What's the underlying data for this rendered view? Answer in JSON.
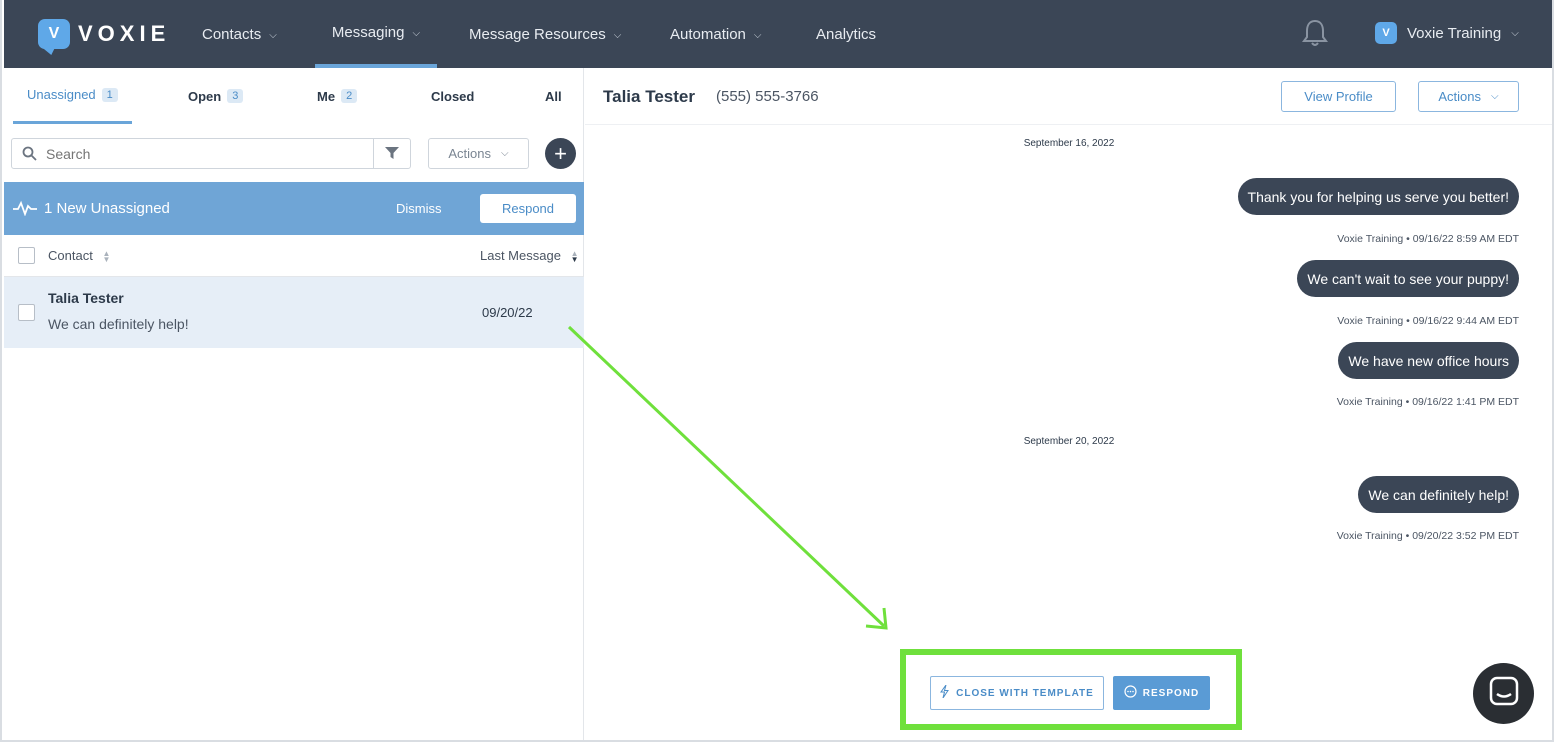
{
  "brand": {
    "name": "VOXIE",
    "mark": "V"
  },
  "nav": {
    "items": [
      {
        "label": "Contacts",
        "has_menu": true
      },
      {
        "label": "Messaging",
        "has_menu": true,
        "active": true
      },
      {
        "label": "Message Resources",
        "has_menu": true
      },
      {
        "label": "Automation",
        "has_menu": true
      },
      {
        "label": "Analytics",
        "has_menu": false
      }
    ],
    "bell_icon": "bell-icon",
    "account": {
      "name": "Voxie Training",
      "mark": "V"
    }
  },
  "tabs": [
    {
      "label": "Unassigned",
      "count": "1",
      "active": true
    },
    {
      "label": "Open",
      "count": "3"
    },
    {
      "label": "Me",
      "count": "2"
    },
    {
      "label": "Closed",
      "count": ""
    },
    {
      "label": "All",
      "count": ""
    }
  ],
  "search": {
    "placeholder": "Search",
    "value": ""
  },
  "left_actions": {
    "label": "Actions"
  },
  "banner": {
    "text": "1 New Unassigned",
    "dismiss": "Dismiss",
    "respond": "Respond"
  },
  "table": {
    "headers": {
      "contact": "Contact",
      "last_message": "Last Message"
    },
    "rows": [
      {
        "name": "Talia Tester",
        "preview": "We can definitely help!",
        "date": "09/20/22"
      }
    ]
  },
  "conversation": {
    "contact_name": "Talia Tester",
    "phone": "(555) 555-3766",
    "view_profile": "View Profile",
    "actions": "Actions",
    "dates": [
      "September 16, 2022",
      "September 20, 2022"
    ],
    "messages": [
      {
        "text": "Thank you for helping us serve you better!",
        "meta": "Voxie Training • 09/16/22 8:59 AM EDT"
      },
      {
        "text": "We can't wait to see your puppy!",
        "meta": "Voxie Training • 09/16/22 9:44 AM EDT"
      },
      {
        "text": "We have new office hours",
        "meta": "Voxie Training • 09/16/22 1:41 PM EDT"
      },
      {
        "text": "We can definitely help!",
        "meta": "Voxie Training • 09/20/22 3:52 PM EDT"
      }
    ],
    "close_with_template": "CLOSE WITH TEMPLATE",
    "respond": "RESPOND"
  },
  "colors": {
    "nav_bg": "#3b4656",
    "accent": "#6fa5d6",
    "highlight": "#6fe03c"
  }
}
